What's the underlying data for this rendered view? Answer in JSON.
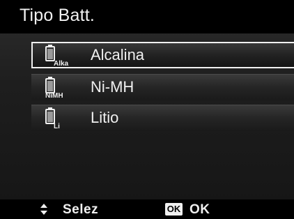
{
  "header": {
    "title": "Tipo Batt."
  },
  "menu": {
    "items": [
      {
        "label": "Alcalina",
        "icon": "battery-alkaline-icon",
        "icon_text": "Alka",
        "selected": true
      },
      {
        "label": "Ni-MH",
        "icon": "battery-nimh-icon",
        "icon_text": "NiMH",
        "selected": false
      },
      {
        "label": "Litio",
        "icon": "battery-lithium-icon",
        "icon_text": "Li",
        "selected": false
      }
    ]
  },
  "footer": {
    "nav_icon": "up-down-arrows-icon",
    "nav_label": "Selez",
    "ok_icon_text": "OK",
    "ok_label": "OK"
  },
  "colors": {
    "title_bar": "#000000",
    "text": "#f0f0f0",
    "selection_border": "#f0f0f0"
  }
}
